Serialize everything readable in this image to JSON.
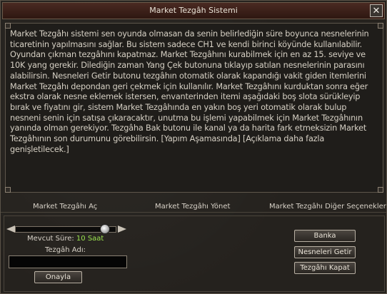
{
  "window": {
    "title": "Market Tezgâh Sistemi",
    "close_glyph": "✕"
  },
  "info_text": "Market Tezgâhı sistemi sen oyunda olmasan da senin belirlediğin süre boyunca nesnelerinin ticaretinin yapılmasını sağlar. Bu sistem sadece CH1 ve kendi birinci köyünde kullanılabilir. Oyundan çıkman tezgâhını kapatmaz. Market Tezgâhını kurabilmek için en az 15. seviye ve 10K yang gerekir. Dilediğin zaman Yang Çek butonuna tıklayıp satılan nesnelerinin parasını alabilirsin. Nesneleri Getir butonu tezgâhın otomatik olarak kapandığı vakit giden itemlerini Market Tezgâhı depondan geri çekmek için kullanılır. Market Tezgâhını kurduktan sonra eğer ekstra olarak nesne eklemek istersen, envanterinden itemi aşağıdaki boş slota sürükleyip bırak ve fiyatını gir, sistem Market Tezgâhında en yakın boş yeri otomatik olarak bulup nesneni senin için satışa çıkaracaktır, unutma bu işlemi yapabilmek için Market Tezgâhının yanında olman gerekiyor. Tezgâha Bak butonu ile kanal ya da harita fark etmeksizin Market Tezgâhının son durumunu görebilirsin. [Yapım Aşamasında] [Açıklama daha fazla genişletilecek.]",
  "sections": {
    "open": "Market Tezgâhı Aç",
    "manage": "Market Tezgâhı Yönet",
    "other": "Market Tezgâhı Diğer Seçenekler"
  },
  "open_panel": {
    "duration_label": "Mevcut Süre: ",
    "duration_value": "10 Saat",
    "duration_fill": 0.9,
    "name_label": "Tezgâh Adı:",
    "name_value": "",
    "confirm_label": "Onayla"
  },
  "right_buttons": [
    "Banka",
    "Nesneleri Getir",
    "Tezgâhı Kapat"
  ],
  "colors": {
    "accent_green": "#9be34f",
    "title_bar": "#3b1f18"
  }
}
